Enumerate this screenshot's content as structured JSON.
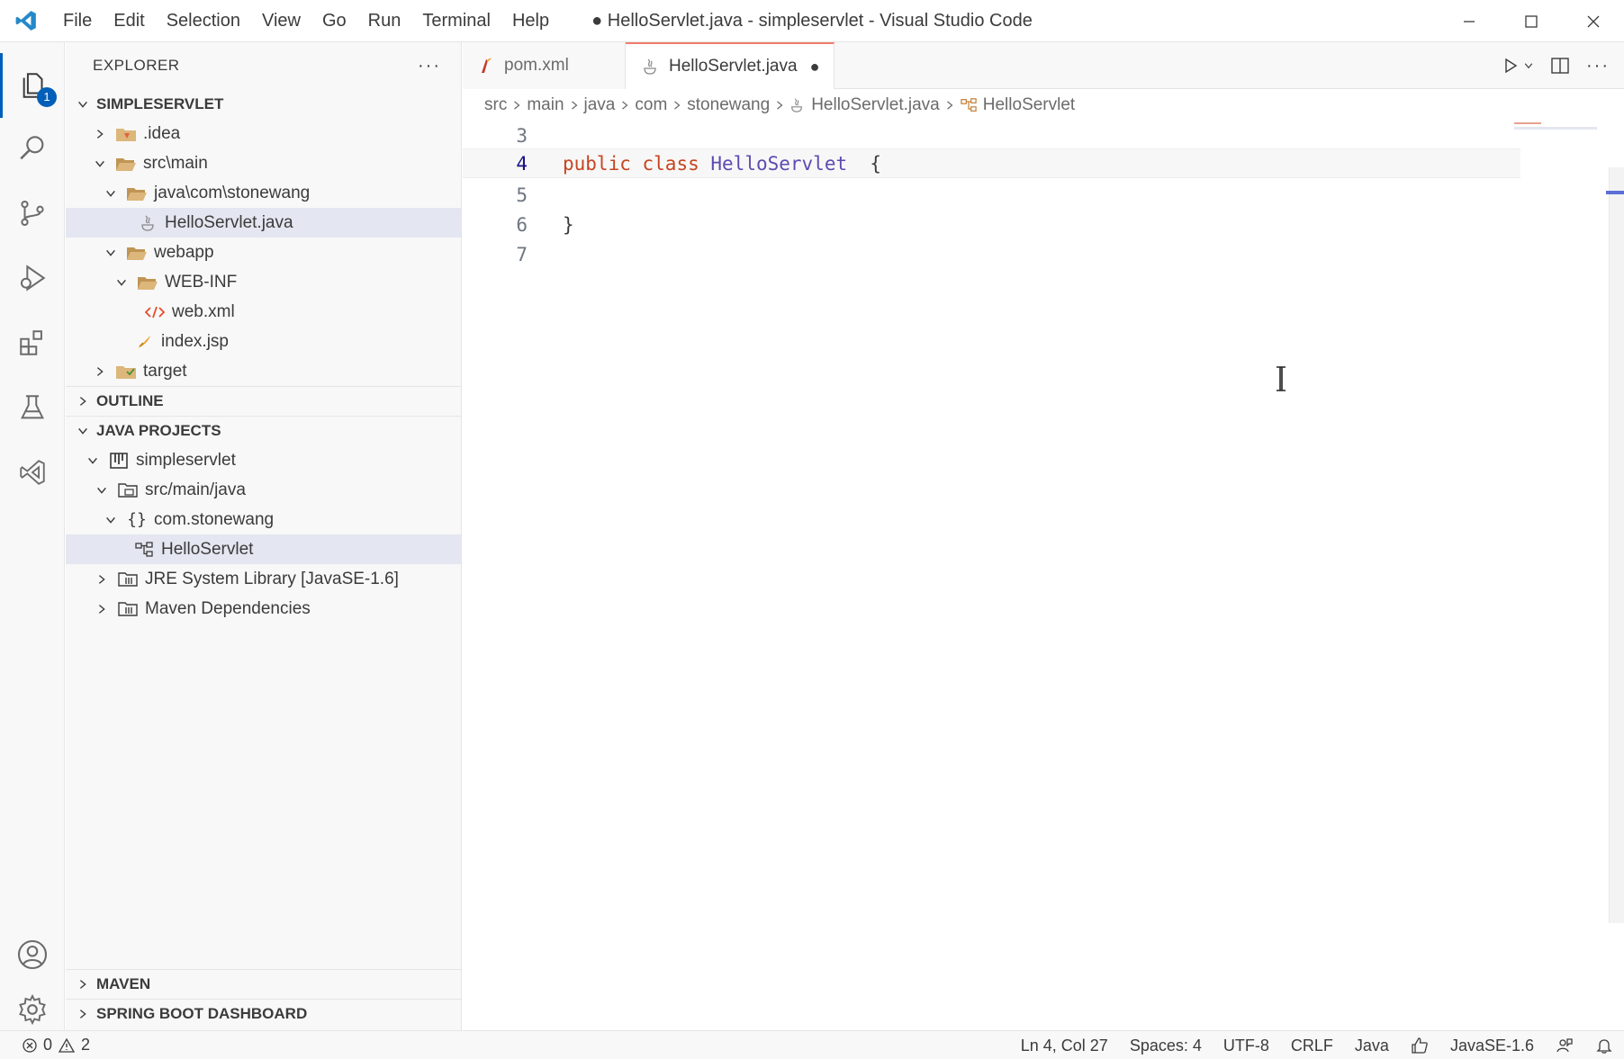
{
  "window": {
    "title": "● HelloServlet.java - simpleservlet - Visual Studio Code"
  },
  "menu": [
    "File",
    "Edit",
    "Selection",
    "View",
    "Go",
    "Run",
    "Terminal",
    "Help"
  ],
  "activity": {
    "explorer_badge": "1"
  },
  "sidebar": {
    "title": "EXPLORER",
    "more": "···",
    "workspace": "SIMPLESERVLET",
    "tree": [
      {
        "label": ".idea"
      },
      {
        "label": "src\\main"
      },
      {
        "label": "java\\com\\stonewang"
      },
      {
        "label": "HelloServlet.java"
      },
      {
        "label": "webapp"
      },
      {
        "label": "WEB-INF"
      },
      {
        "label": "web.xml"
      },
      {
        "label": "index.jsp"
      },
      {
        "label": "target"
      }
    ],
    "outline": "OUTLINE",
    "java_projects": "JAVA PROJECTS",
    "projects": [
      {
        "label": "simpleservlet"
      },
      {
        "label": "src/main/java"
      },
      {
        "label": "com.stonewang"
      },
      {
        "label": "HelloServlet"
      },
      {
        "label": "JRE System Library [JavaSE-1.6]"
      },
      {
        "label": "Maven Dependencies"
      }
    ],
    "maven": "MAVEN",
    "spring": "SPRING BOOT DASHBOARD"
  },
  "tabs": [
    {
      "label": "pom.xml"
    },
    {
      "label": "HelloServlet.java",
      "dirty": "●"
    }
  ],
  "breadcrumb": [
    "src",
    "main",
    "java",
    "com",
    "stonewang",
    "HelloServlet.java",
    "HelloServlet"
  ],
  "editor": {
    "lines": [
      {
        "num": "3"
      },
      {
        "num": "4",
        "kw1": "public",
        "kw2": "class",
        "cls": "HelloServlet",
        "punc": "{"
      },
      {
        "num": "5"
      },
      {
        "num": "6",
        "punc": "}"
      },
      {
        "num": "7"
      }
    ]
  },
  "status": {
    "errors": "0",
    "warnings": "2",
    "position": "Ln 4, Col 27",
    "spaces": "Spaces: 4",
    "encoding": "UTF-8",
    "eol": "CRLF",
    "language": "Java",
    "jdk": "JavaSE-1.6"
  },
  "colors": {
    "accent": "#005fb8",
    "keyword": "#c7441f",
    "class_name": "#5e4ab0",
    "active_tab_border": "#f27c6b"
  }
}
